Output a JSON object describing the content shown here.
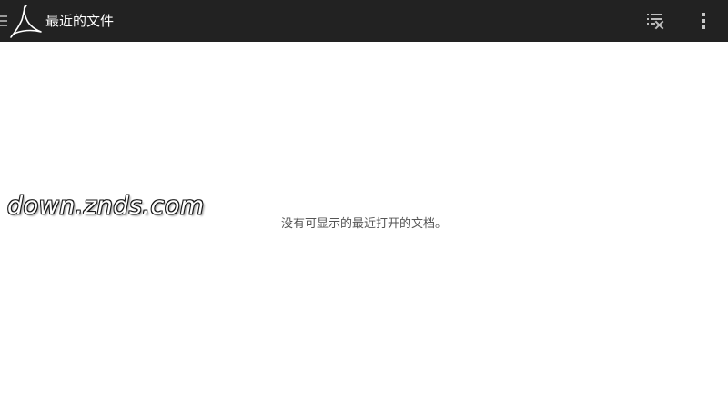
{
  "app_bar": {
    "title": "最近的文件",
    "background": "#222222",
    "title_color": "#ffffff",
    "icons": {
      "nav": "hamburger-icon",
      "logo": "adobe-reader-logo-icon",
      "clear": "clear-recent-list-icon",
      "more": "more-vertical-icon"
    }
  },
  "content": {
    "empty_message": "没有可显示的最近打开的文档。",
    "text_color": "#555555"
  },
  "watermark": {
    "text": "down.znds.com"
  }
}
